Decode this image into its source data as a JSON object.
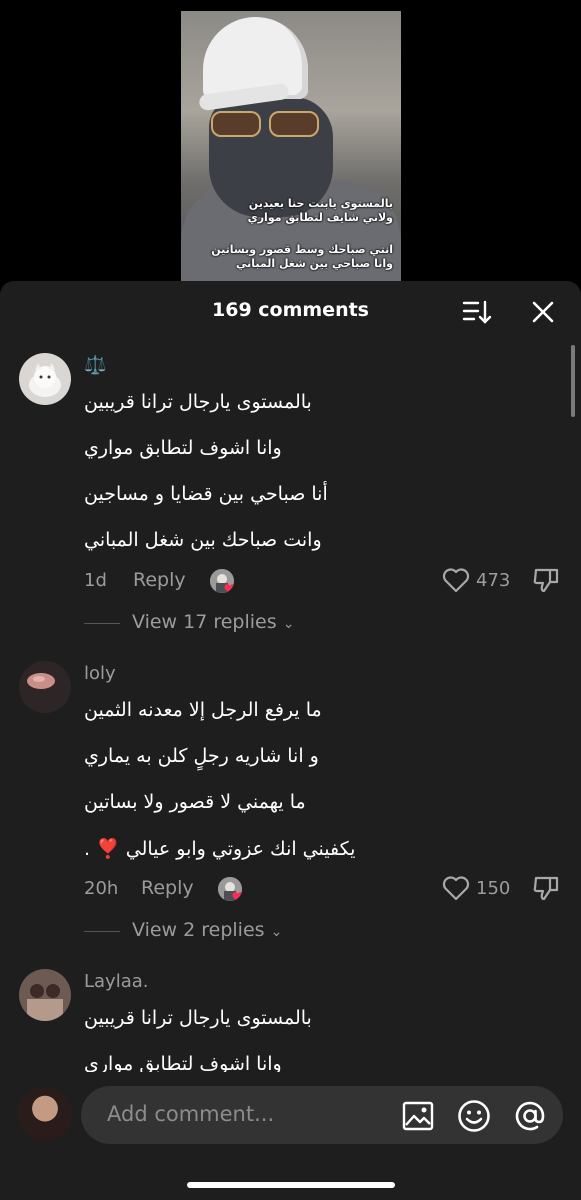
{
  "video": {
    "caption_lines": [
      "بالمستوى يابنت حنا بعيدين",
      "ولاني شايف لتطابق مواري",
      "انتي صباحك وسط قصور وبساتين",
      "وانا صباحي بين شغل المباني"
    ]
  },
  "sheet": {
    "title": "169 comments"
  },
  "comments": [
    {
      "username": "⚖️",
      "lines": [
        "بالمستوى يارجال ترانا قريبين",
        "وانا اشوف لتطابق مواري",
        "أنا صباحي بين قضايا و مساجين",
        "وانت صباحك بين شغل المباني"
      ],
      "time": "1d",
      "reply_label": "Reply",
      "likes": "473",
      "view_replies": "View 17 replies"
    },
    {
      "username": "loly",
      "lines": [
        "ما يرفع الرجل إلا معدنه الثمين",
        "و انا شاريه رجلٍ كلن به يماري",
        "ما يهمني لا قصور ولا بساتين",
        "يكفيني انك عزوتي وابو عيالي ❣️ ."
      ],
      "time": "20h",
      "reply_label": "Reply",
      "likes": "150",
      "view_replies": "View 2 replies"
    },
    {
      "username": "Laylaa.",
      "lines": [
        "بالمستوى يارجال ترانا قريبين",
        "وانا اشوف لتطابق مواري"
      ]
    }
  ],
  "composer": {
    "placeholder": "Add comment..."
  },
  "icons": {
    "sort": "sort-icon",
    "close": "close-icon",
    "like": "heart-outline-icon",
    "dislike": "thumbs-down-icon",
    "image": "image-icon",
    "emoji": "emoji-icon",
    "mention": "at-icon"
  }
}
